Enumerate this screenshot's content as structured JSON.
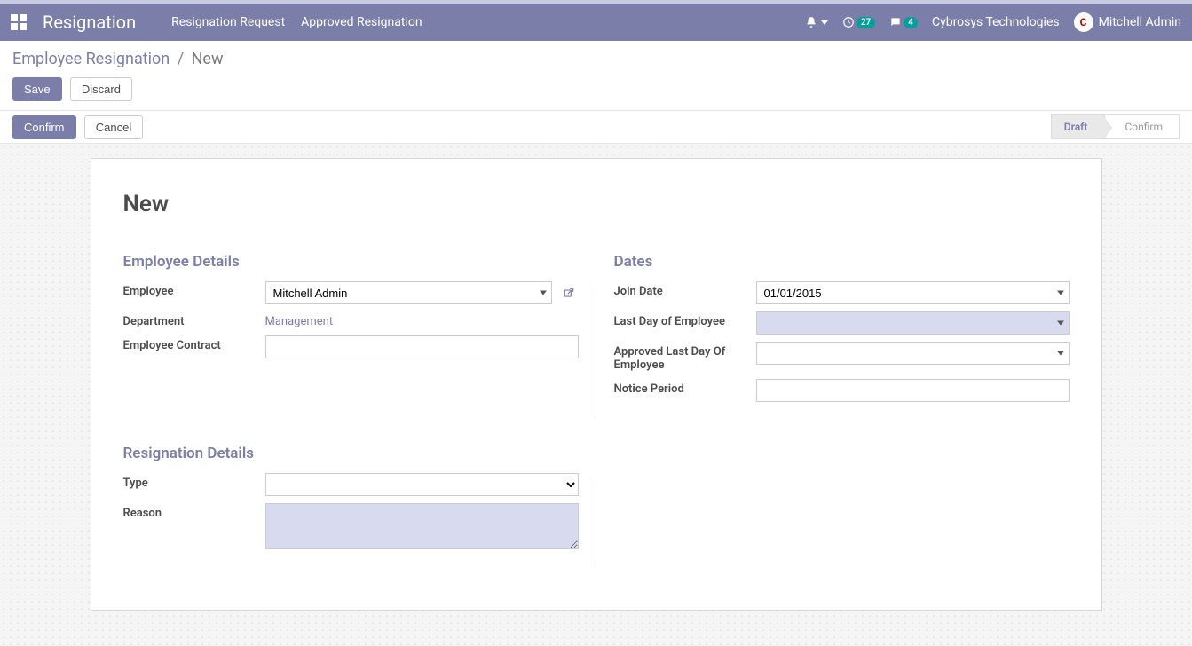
{
  "navbar": {
    "brand": "Resignation",
    "menu": [
      "Resignation Request",
      "Approved Resignation"
    ],
    "activity_count": "27",
    "message_count": "4",
    "company": "Cybrosys Technologies",
    "user": "Mitchell Admin"
  },
  "breadcrumb": {
    "root": "Employee Resignation",
    "current": "New"
  },
  "buttons": {
    "save": "Save",
    "discard": "Discard",
    "confirm": "Confirm",
    "cancel": "Cancel"
  },
  "status": {
    "draft": "Draft",
    "confirm": "Confirm"
  },
  "form": {
    "title": "New",
    "employee_section": "Employee Details",
    "dates_section": "Dates",
    "resignation_section": "Resignation Details",
    "labels": {
      "employee": "Employee",
      "department": "Department",
      "contract": "Employee Contract",
      "join_date": "Join Date",
      "last_day": "Last Day of Employee",
      "approved_last_day": "Approved Last Day Of Employee",
      "notice_period": "Notice Period",
      "type": "Type",
      "reason": "Reason"
    },
    "values": {
      "employee": "Mitchell Admin",
      "department": "Management",
      "contract": "",
      "join_date": "01/01/2015",
      "last_day": "",
      "approved_last_day": "",
      "notice_period": "",
      "type": "",
      "reason": ""
    }
  },
  "colors": {
    "primary": "#7b7ea8",
    "required_bg": "#d8daf0",
    "badge": "#00a09d"
  }
}
